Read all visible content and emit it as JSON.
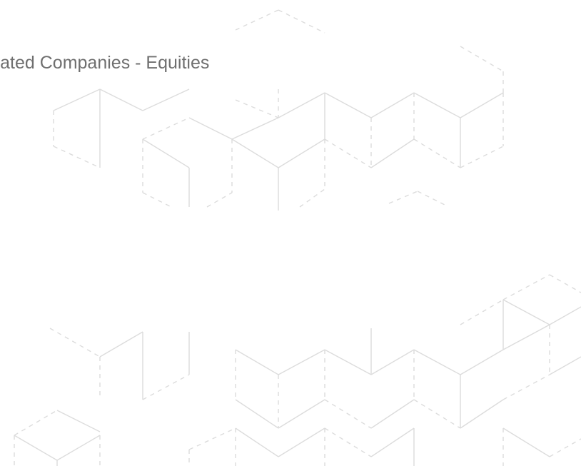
{
  "slide": {
    "title": "porated Companies - Equities"
  },
  "colors": {
    "background": "#ffffff",
    "title_text": "#6f6f6f",
    "pattern_line": "#dcdcdc"
  }
}
